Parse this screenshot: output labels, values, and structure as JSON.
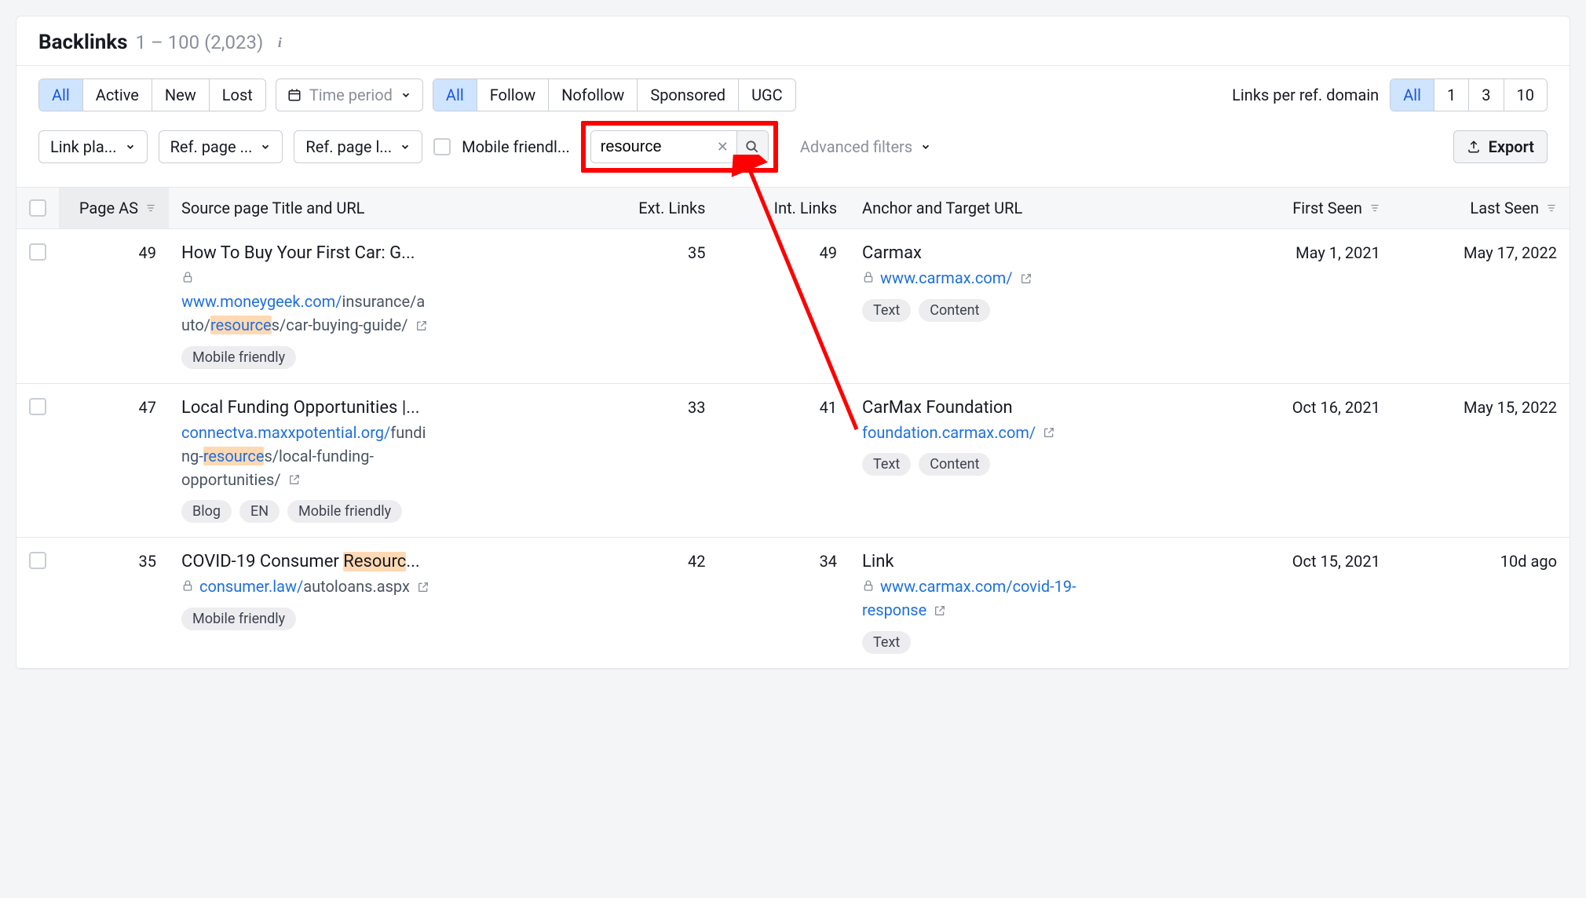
{
  "header": {
    "title": "Backlinks",
    "range": "1 – 100 (2,023)"
  },
  "filters": {
    "status_segments": [
      "All",
      "Active",
      "New",
      "Lost"
    ],
    "status_active": "All",
    "time_period_placeholder": "Time period",
    "follow_segments": [
      "All",
      "Follow",
      "Nofollow",
      "Sponsored",
      "UGC"
    ],
    "follow_active": "All",
    "links_per_domain_label": "Links per ref. domain",
    "links_per_domain_segments": [
      "All",
      "1",
      "3",
      "10"
    ],
    "links_per_domain_active": "All",
    "link_placement_label": "Link pla...",
    "ref_page_label": "Ref. page ...",
    "ref_page_loc_label": "Ref. page l...",
    "mobile_friendly_label": "Mobile friendl...",
    "search_value": "resource",
    "advanced_filters_label": "Advanced filters",
    "export_label": "Export"
  },
  "columns": {
    "page_as": "Page AS",
    "source": "Source page Title and URL",
    "ext_links": "Ext. Links",
    "int_links": "Int. Links",
    "anchor": "Anchor and Target URL",
    "first_seen": "First Seen",
    "last_seen": "Last Seen"
  },
  "rows": [
    {
      "page_as": "49",
      "title": "How To Buy Your First Car: G...",
      "url_locked": true,
      "url_pre": "www.moneygeek.com/",
      "url_mid": "insurance/auto/",
      "url_hl": "resource",
      "url_post": "s/car-buying-guide/",
      "tags": [
        "Mobile friendly"
      ],
      "ext": "35",
      "int": "49",
      "anchor_title": "Carmax",
      "anchor_locked": true,
      "anchor_url": "www.carmax.com/",
      "anchor_tags": [
        "Text",
        "Content"
      ],
      "first_seen": "May 1, 2021",
      "last_seen": "May 17, 2022"
    },
    {
      "page_as": "47",
      "title": "Local Funding Opportunities |...",
      "url_locked": false,
      "url_pre": "connectva.maxxpotential.org/",
      "url_mid": "funding-",
      "url_hl": "resource",
      "url_post": "s/local-funding-opportunities/",
      "tags": [
        "Blog",
        "EN",
        "Mobile friendly"
      ],
      "ext": "33",
      "int": "41",
      "anchor_title": "CarMax Foundation",
      "anchor_locked": false,
      "anchor_url": "foundation.carmax.com/",
      "anchor_tags": [
        "Text",
        "Content"
      ],
      "first_seen": "Oct 16, 2021",
      "last_seen": "May 15, 2022"
    },
    {
      "page_as": "35",
      "title_pre": "COVID-19 Consumer ",
      "title_hl": "Resourc",
      "title_post": "...",
      "url_locked": true,
      "url_pre": "consumer.law/",
      "url_mid": "",
      "url_hl": "",
      "url_post": "autoloans.aspx",
      "tags": [
        "Mobile friendly"
      ],
      "ext": "42",
      "int": "34",
      "anchor_title": "Link",
      "anchor_locked": true,
      "anchor_url": "www.carmax.com/covid-19-response",
      "anchor_tags": [
        "Text"
      ],
      "first_seen": "Oct 15, 2021",
      "last_seen": "10d ago"
    }
  ]
}
